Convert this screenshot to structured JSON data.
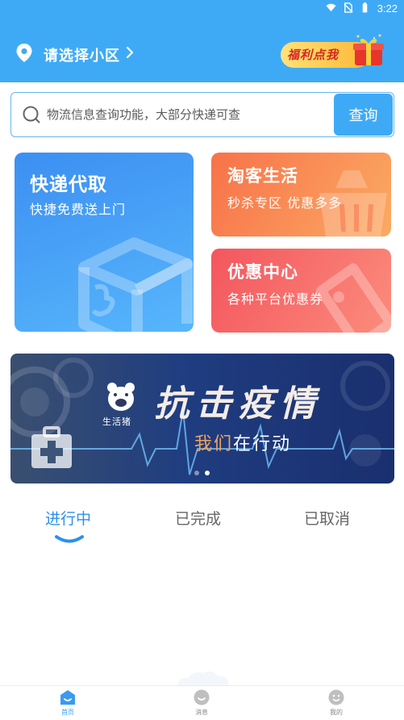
{
  "status_bar": {
    "time": "3:22"
  },
  "header": {
    "location_label": "请选择小区",
    "welfare_label": "福利点我",
    "background": "#3eaaf6"
  },
  "search": {
    "placeholder": "物流信息查询功能，大部分快递可查",
    "button_label": "查询"
  },
  "cards": {
    "express": {
      "title": "快递代取",
      "subtitle": "快捷免费送上门",
      "color": "#3c8ff2"
    },
    "taoke": {
      "title": "淘客生活",
      "subtitle": "秒杀专区  优惠多多",
      "color": "#f8724a"
    },
    "coupon": {
      "title": "优惠中心",
      "subtitle": "各种平台优惠券",
      "color": "#f4565e"
    }
  },
  "banner": {
    "brand": "生活猪",
    "headline": "抗击疫情",
    "slogan_highlight": "我们",
    "slogan_rest": "在行动",
    "page_count": 2,
    "active_page": 2
  },
  "order_tabs": [
    {
      "label": "进行中",
      "active": true
    },
    {
      "label": "已完成",
      "active": false
    },
    {
      "label": "已取消",
      "active": false
    }
  ],
  "bottom_nav": [
    {
      "label": "首页",
      "icon": "home-icon",
      "active": true
    },
    {
      "label": "消息",
      "icon": "message-icon",
      "active": false
    },
    {
      "label": "我的",
      "icon": "profile-icon",
      "active": false
    }
  ]
}
